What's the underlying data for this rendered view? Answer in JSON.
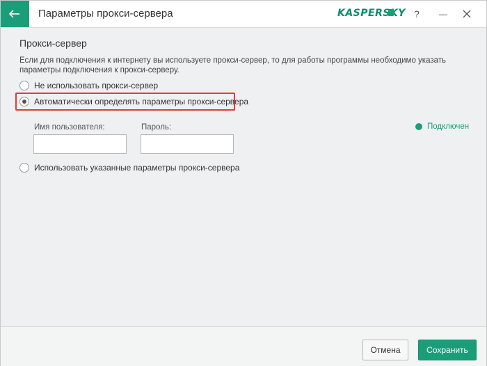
{
  "window": {
    "title": "Параметры прокси-сервера",
    "brand": "KASPERSKY",
    "help_label": "?"
  },
  "content": {
    "section_title": "Прокси-сервер",
    "description": "Если для подключения к интернету вы используете прокси-сервер, то для работы программы необходимо указать параметры подключения к прокси-серверу.",
    "options": [
      {
        "label": "Не использовать прокси-сервер",
        "selected": false
      },
      {
        "label": "Автоматически определять параметры прокси-сервера",
        "selected": true
      },
      {
        "label": "Использовать указанные параметры прокси-сервера",
        "selected": false
      }
    ],
    "username_label": "Имя пользователя:",
    "username_value": "",
    "password_label": "Пароль:",
    "password_value": "",
    "status_text": "Подключен"
  },
  "footer": {
    "cancel_label": "Отмена",
    "save_label": "Сохранить"
  },
  "colors": {
    "accent": "#1a9e7a",
    "highlight": "#e23b3b",
    "background": "#eef0f1"
  }
}
